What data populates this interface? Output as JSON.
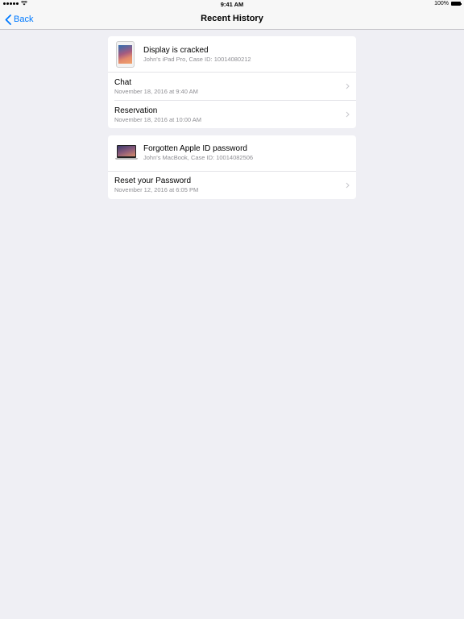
{
  "status_bar": {
    "time": "9:41 AM",
    "battery": "100%",
    "signal_icon": "signal-dots-icon",
    "wifi_icon": "wifi-icon",
    "battery_icon": "battery-icon"
  },
  "nav": {
    "back_label": "Back",
    "title": "Recent History",
    "accent_color": "#007aff"
  },
  "cases": [
    {
      "device_icon": "ipad-icon",
      "title": "Display is cracked",
      "subtitle": "John's iPad Pro, Case ID: 10014080212",
      "items": [
        {
          "title": "Chat",
          "date": "November 18, 2016 at 9:40 AM"
        },
        {
          "title": "Reservation",
          "date": "November 18, 2016 at 10:00 AM"
        }
      ]
    },
    {
      "device_icon": "macbook-icon",
      "title": "Forgotten Apple ID password",
      "subtitle": "John's MacBook, Case ID: 10014082506",
      "items": [
        {
          "title": "Reset your Password",
          "date": "November 12, 2016 at 6:05 PM"
        }
      ]
    }
  ]
}
